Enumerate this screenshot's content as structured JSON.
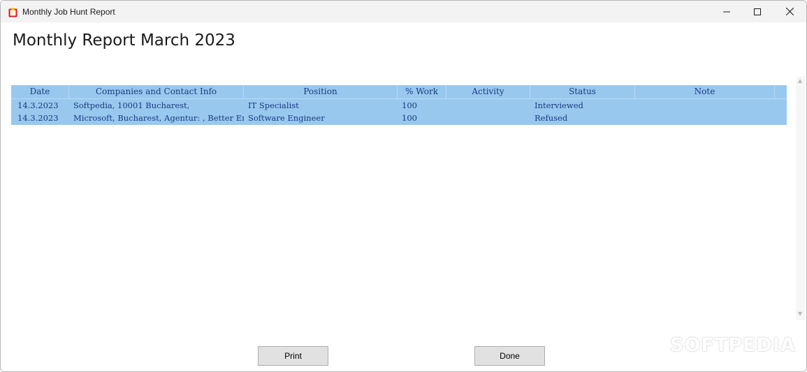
{
  "window": {
    "title": "Monthly Job Hunt Report",
    "icon": "clipboard-icon",
    "controls": {
      "minimize": "minimize-icon",
      "maximize": "maximize-icon",
      "close": "close-icon"
    }
  },
  "report": {
    "title": "Monthly Report March 2023"
  },
  "table": {
    "columns": [
      "Date",
      "Companies and Contact Info",
      "Position",
      "% Work",
      "Activity",
      "Status",
      "Note"
    ],
    "rows": [
      [
        "14.3.2023",
        "Softpedia, 10001 Bucharest,",
        "IT Specialist",
        "100",
        "",
        "Interviewed",
        ""
      ],
      [
        "14.3.2023",
        "Microsoft, Bucharest, Agentur: , Better Empl",
        "Software Engineer",
        "100",
        "",
        "Refused",
        ""
      ]
    ]
  },
  "buttons": {
    "print": "Print",
    "done": "Done"
  },
  "watermark": "SOFTPEDIA",
  "colors": {
    "grid_background": "#99c8ee",
    "grid_text": "#173a80",
    "app_icon": "#e81123"
  }
}
